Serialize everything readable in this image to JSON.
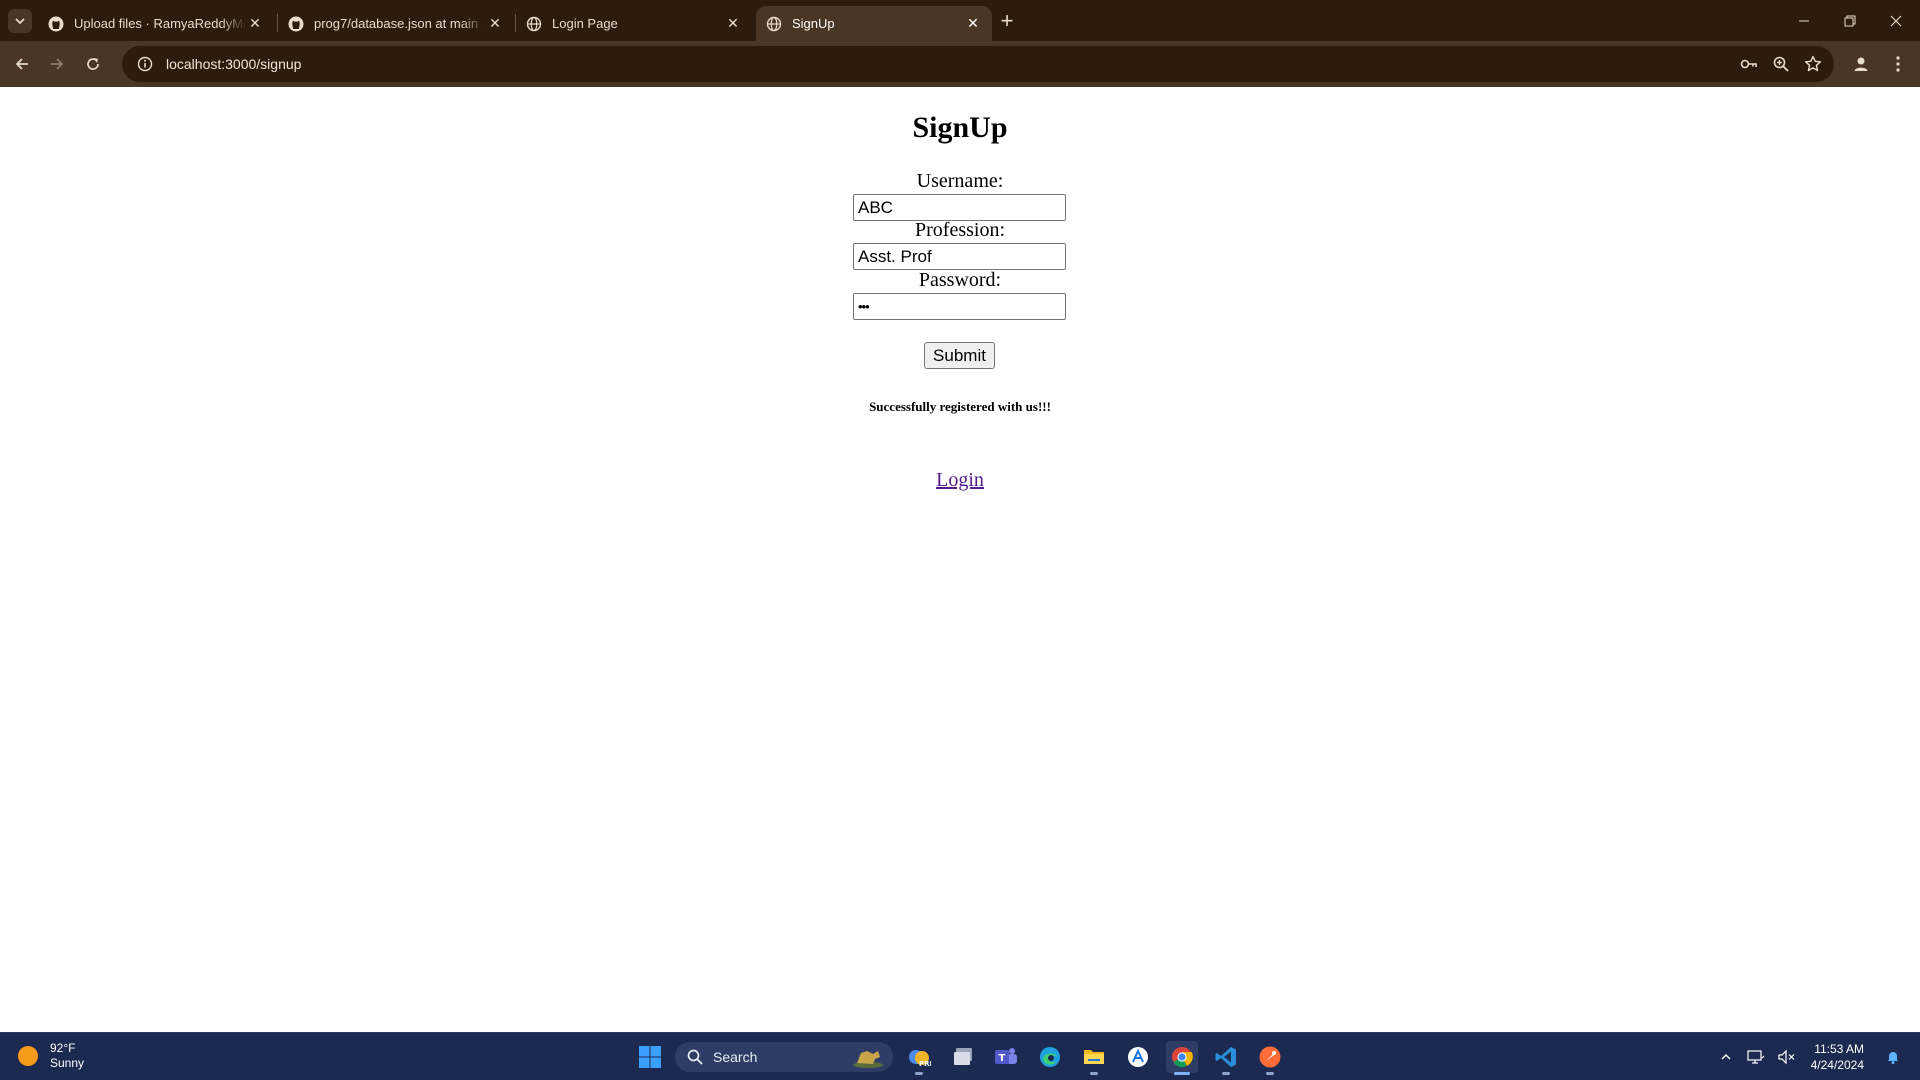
{
  "browser": {
    "tabs": [
      {
        "title": "Upload files · RamyaReddyM/c",
        "favicon": "github-icon"
      },
      {
        "title": "prog7/database.json at main ·",
        "favicon": "github-icon"
      },
      {
        "title": "Login Page",
        "favicon": "globe-icon"
      },
      {
        "title": "SignUp",
        "favicon": "globe-icon",
        "active": true
      }
    ],
    "url": "localhost:3000/signup"
  },
  "page": {
    "title": "SignUp",
    "username_label": "Username:",
    "username_value": "ABC",
    "profession_label": "Profession:",
    "profession_value": "Asst. Prof",
    "password_label": "Password:",
    "password_value": "•••",
    "submit_label": "Submit",
    "status_message": "Successfully registered with us!!!",
    "login_link": "Login"
  },
  "taskbar": {
    "weather_temp": "92°F",
    "weather_desc": "Sunny",
    "search_placeholder": "Search",
    "time": "11:53 AM",
    "date": "4/24/2024"
  },
  "colors": {
    "tabbar_bg": "#2b1c0e",
    "toolbar_bg": "#4a3624",
    "taskbar_bg": "#1c2a52",
    "link_visited": "#551a8b"
  }
}
